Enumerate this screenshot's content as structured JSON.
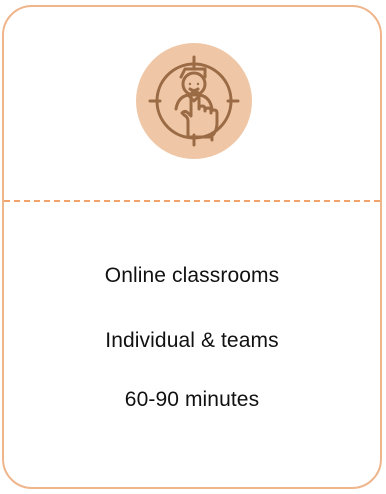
{
  "card": {
    "icon": "touch-hand-person-icon",
    "lines": [
      "Online classrooms",
      "Individual & teams",
      "60-90 minutes"
    ]
  },
  "colors": {
    "border": "#efb58b",
    "divider": "#f0a36a",
    "icon_bg": "#efc7a6",
    "icon_stroke": "#9a6b45"
  }
}
